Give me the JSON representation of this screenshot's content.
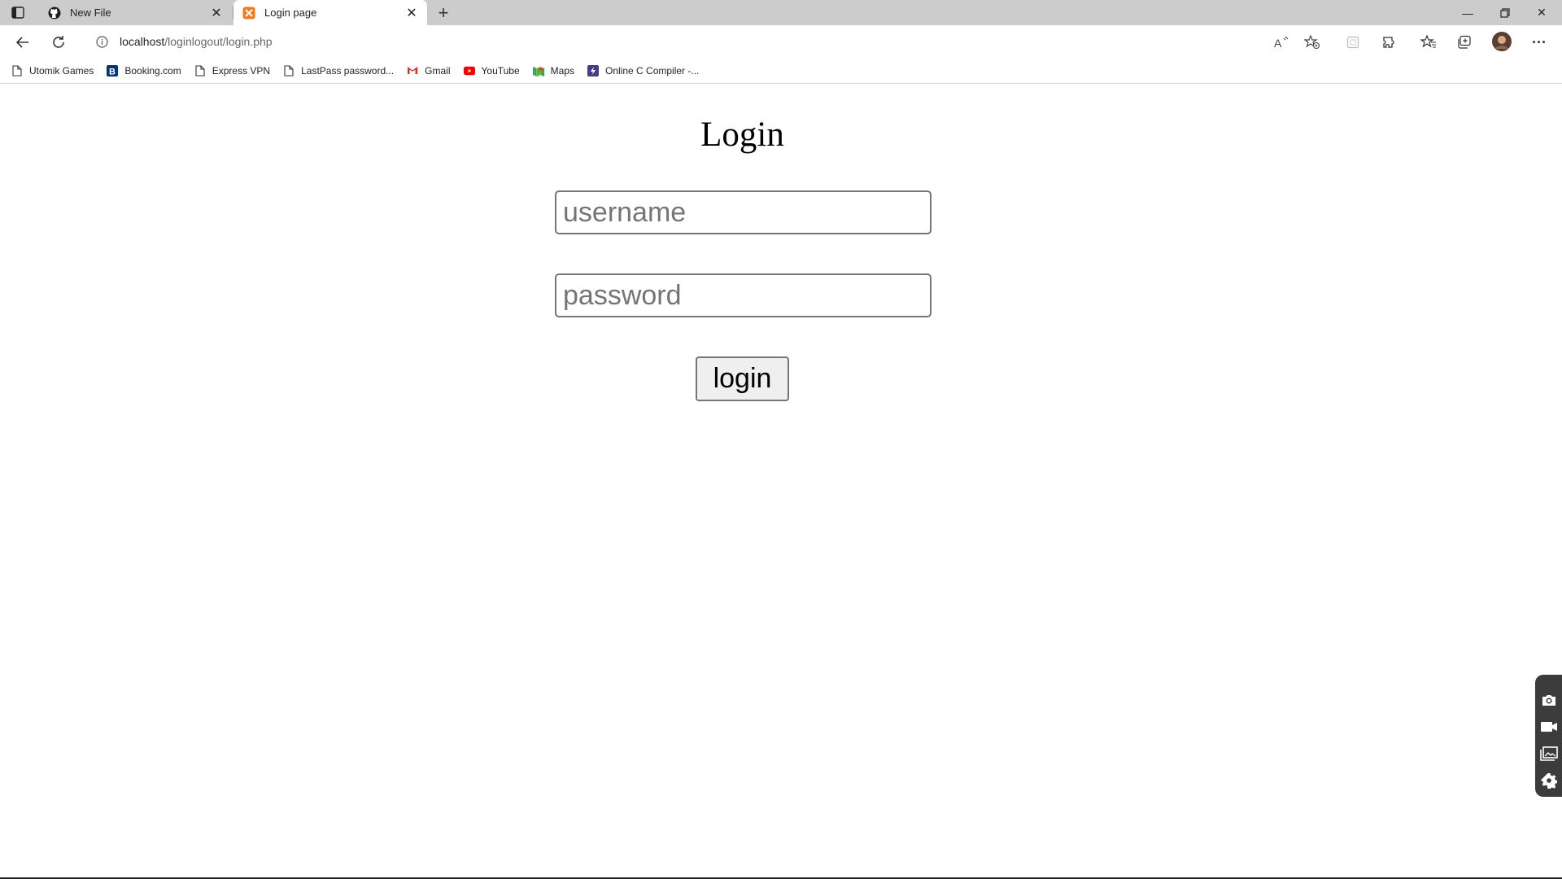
{
  "browser": {
    "tabs": [
      {
        "title": "New File",
        "icon": "github-icon"
      },
      {
        "title": "Login page",
        "icon": "xampp-icon"
      }
    ],
    "address": {
      "host": "localhost",
      "path": "/loginlogout/login.php"
    },
    "bookmarks": [
      {
        "label": "Utomik Games",
        "icon": "page-icon"
      },
      {
        "label": "Booking.com",
        "icon": "booking-icon"
      },
      {
        "label": "Express VPN",
        "icon": "page-icon"
      },
      {
        "label": "LastPass password...",
        "icon": "page-icon"
      },
      {
        "label": "Gmail",
        "icon": "gmail-icon"
      },
      {
        "label": "YouTube",
        "icon": "youtube-icon"
      },
      {
        "label": "Maps",
        "icon": "maps-icon"
      },
      {
        "label": "Online C Compiler -...",
        "icon": "compiler-icon"
      }
    ]
  },
  "page": {
    "title": "Login",
    "username_placeholder": "username",
    "password_placeholder": "password",
    "login_label": "login"
  },
  "colors": {
    "tabstrip": "#cccccc",
    "field_border": "#767676",
    "button_bg": "#efefef"
  }
}
